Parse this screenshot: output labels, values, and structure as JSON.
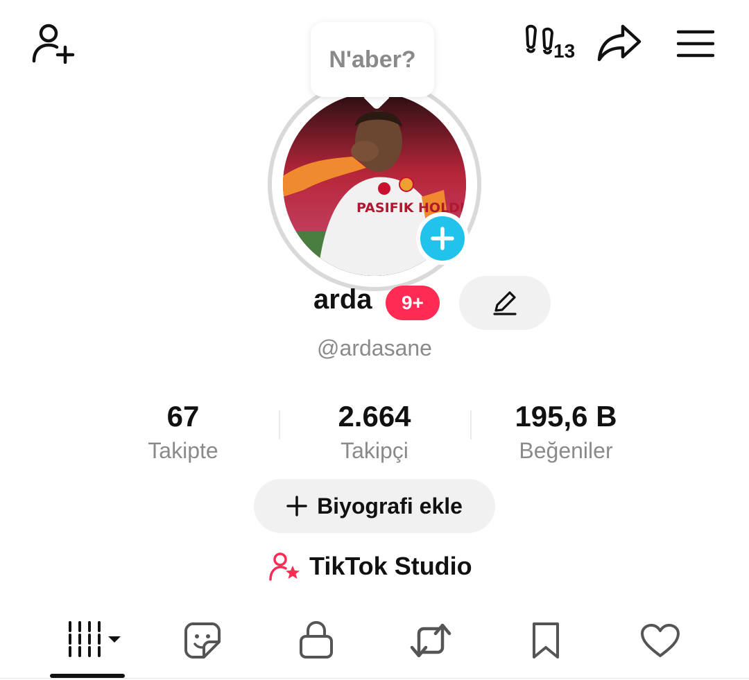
{
  "header": {
    "friends_icon": "add-user-icon",
    "footprint_count": "13",
    "share_icon": "share-icon",
    "menu_icon": "hamburger-menu-icon"
  },
  "profile": {
    "status_bubble": "N'aber?",
    "display_name": "arda",
    "notification_badge": "9+",
    "handle": "@ardasane",
    "avatar_label": "PASIFIK HOLDING"
  },
  "stats": [
    {
      "value": "67",
      "label": "Takipte"
    },
    {
      "value": "2.664",
      "label": "Takipçi"
    },
    {
      "value": "195,6 B",
      "label": "Beğeniler"
    }
  ],
  "actions": {
    "bio_label": "Biyografi ekle",
    "studio_label": "TikTok Studio"
  },
  "tabs": [
    {
      "name": "videos-grid",
      "icon": "grid-icon",
      "active": true
    },
    {
      "name": "stickers",
      "icon": "sticker-icon",
      "active": false
    },
    {
      "name": "private",
      "icon": "lock-icon",
      "active": false
    },
    {
      "name": "reposts",
      "icon": "repost-icon",
      "active": false
    },
    {
      "name": "saved",
      "icon": "bookmark-icon",
      "active": false
    },
    {
      "name": "liked",
      "icon": "heart-icon",
      "active": false
    }
  ],
  "colors": {
    "accent_pink": "#fe2c55",
    "plus_blue": "#21c2ec",
    "muted_text": "#8a8a8a",
    "button_bg": "#f1f1f2"
  }
}
